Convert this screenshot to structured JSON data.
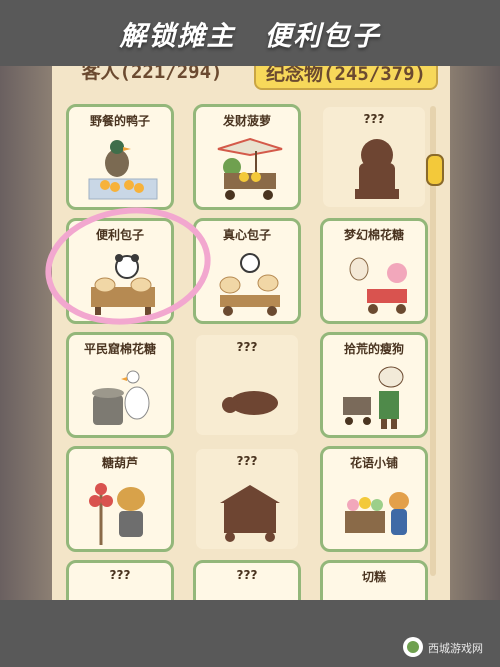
{
  "banner": {
    "title": "解锁摊主　便利包子"
  },
  "tabs": {
    "guests": "客人(221/294)",
    "souvenirs": "纪念物(245/379)"
  },
  "cards": [
    {
      "name": "野餐的鸭子",
      "locked": false,
      "icon": "duck-picnic-icon"
    },
    {
      "name": "发财菠萝",
      "locked": false,
      "icon": "pineapple-cart-icon"
    },
    {
      "name": "???",
      "locked": true,
      "icon": "lion-silhouette-icon"
    },
    {
      "name": "便利包子",
      "locked": false,
      "icon": "panda-bun-stall-icon"
    },
    {
      "name": "真心包子",
      "locked": false,
      "icon": "bun-stall-icon"
    },
    {
      "name": "梦幻棉花糖",
      "locked": false,
      "icon": "cotton-candy-icon"
    },
    {
      "name": "平民窟棉花糖",
      "locked": false,
      "icon": "goose-machine-icon"
    },
    {
      "name": "???",
      "locked": true,
      "icon": "lying-animal-silhouette-icon"
    },
    {
      "name": "拾荒的瘦狗",
      "locked": false,
      "icon": "dog-cart-icon"
    },
    {
      "name": "糖葫芦",
      "locked": false,
      "icon": "candied-haws-icon"
    },
    {
      "name": "???",
      "locked": true,
      "icon": "tent-silhouette-icon"
    },
    {
      "name": "花语小铺",
      "locked": false,
      "icon": "flower-shop-icon"
    },
    {
      "name": "???",
      "locked": true,
      "icon": "unknown-icon"
    },
    {
      "name": "???",
      "locked": true,
      "icon": "unknown-icon"
    },
    {
      "name": "切糕",
      "locked": false,
      "icon": "cake-icon"
    }
  ],
  "watermark": {
    "text": "西城游戏网"
  },
  "colors": {
    "frame": "#595959",
    "screen": "#f3e5c8",
    "card_border": "#93b77a",
    "tab_active": "#f7d85a",
    "highlight": "#f2a7cf"
  }
}
